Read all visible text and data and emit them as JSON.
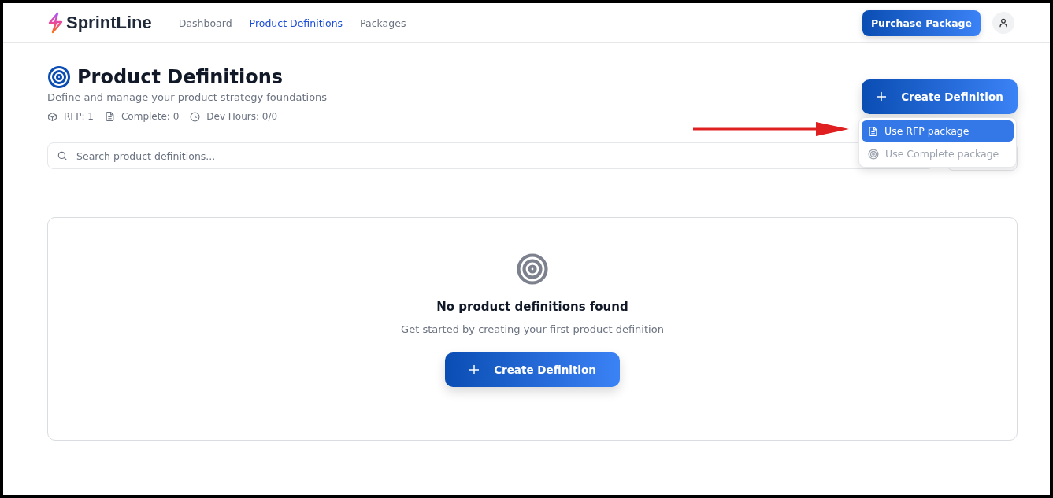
{
  "header": {
    "logo": "SprintLine",
    "nav": [
      {
        "label": "Dashboard",
        "selected": false
      },
      {
        "label": "Product Definitions",
        "selected": true
      },
      {
        "label": "Packages",
        "selected": false
      }
    ],
    "purchase_button": "Purchase Package"
  },
  "page": {
    "title": "Product Definitions",
    "subtitle": "Define and manage your product strategy foundations",
    "stats": [
      "RFP: 1",
      "Complete: 0",
      "Dev Hours: 0/0"
    ],
    "create_button": "Create Definition",
    "menu": [
      {
        "label": "Use RFP package",
        "selected": true,
        "disabled": false
      },
      {
        "label": "Use Complete package",
        "selected": false,
        "disabled": true
      }
    ]
  },
  "search": {
    "placeholder": "Search product definitions..."
  },
  "empty_state": {
    "title": "No product definitions found",
    "message": "Get started by creating your first product definition",
    "button": "Create Definition"
  }
}
